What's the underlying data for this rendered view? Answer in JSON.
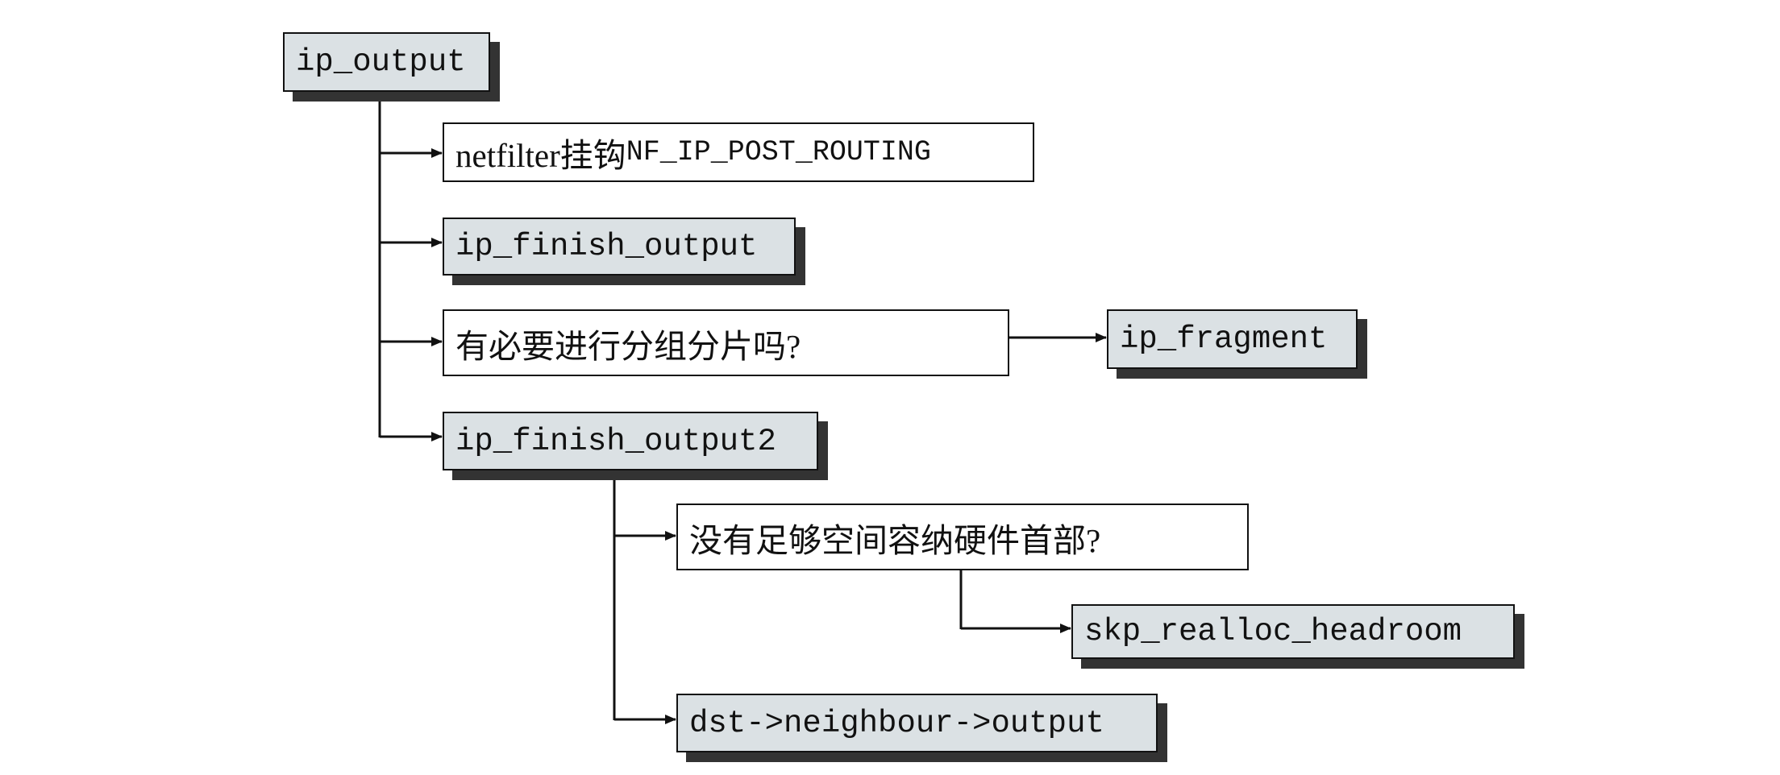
{
  "nodes": {
    "ip_output": "ip_output",
    "netfilter_prefix": "netfilter挂钩",
    "netfilter_hook": "NF_IP_POST_ROUTING",
    "ip_finish_output": "ip_finish_output",
    "fragment_question": "有必要进行分组分片吗?",
    "ip_fragment": "ip_fragment",
    "ip_finish_output2": "ip_finish_output2",
    "headroom_question": "没有足够空间容纳硬件首部?",
    "skb_realloc_headroom": "skp_realloc_headroom",
    "neighbour_output": "dst->neighbour->output"
  },
  "colors": {
    "function_box_fill": "#dbe1e4",
    "shadow": "#333333",
    "line": "#111111",
    "background": "#ffffff"
  }
}
